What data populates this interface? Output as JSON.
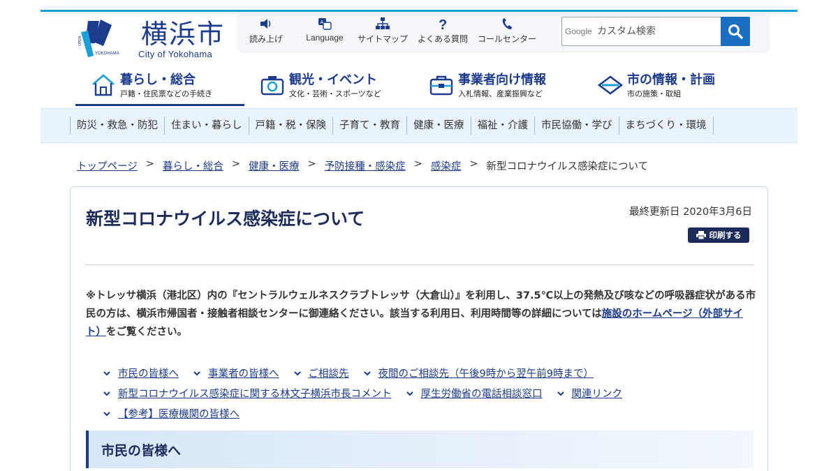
{
  "logo": {
    "mark_text_1": "OPEN",
    "mark_text_2": "YOKOHAMA",
    "kanji": "横浜市",
    "english": "City of Yokohama"
  },
  "utility": [
    {
      "label": "読み上げ",
      "icon": "speaker-icon"
    },
    {
      "label": "Language",
      "icon": "language-icon"
    },
    {
      "label": "サイトマップ",
      "icon": "sitemap-icon"
    },
    {
      "label": "よくある質問",
      "icon": "question-icon"
    },
    {
      "label": "コールセンター",
      "icon": "phone-icon"
    }
  ],
  "search": {
    "brand": "Google",
    "placeholder": "カスタム検索"
  },
  "main_nav": [
    {
      "title": "暮らし・総合",
      "sub": "戸籍・住民票などの手続き",
      "icon": "house-icon",
      "active": true
    },
    {
      "title": "観光・イベント",
      "sub": "文化・芸術・スポーツなど",
      "icon": "camera-icon",
      "active": false
    },
    {
      "title": "事業者向け情報",
      "sub": "入札情報、産業振興など",
      "icon": "briefcase-icon",
      "active": false
    },
    {
      "title": "市の情報・計画",
      "sub": "市の施策・取組",
      "icon": "diamond-icon",
      "active": false
    }
  ],
  "categories": [
    "防災・救急・防犯",
    "住まい・暮らし",
    "戸籍・税・保険",
    "子育て・教育",
    "健康・医療",
    "福祉・介護",
    "市民協働・学び",
    "まちづくり・環境"
  ],
  "breadcrumb": {
    "links": [
      "トップページ",
      "暮らし・総合",
      "健康・医療",
      "予防接種・感染症",
      "感染症"
    ],
    "separator": ">",
    "current": "新型コロナウイルス感染症について"
  },
  "page": {
    "title": "新型コロナウイルス感染症について",
    "updated": "最終更新日 2020年3月6日",
    "print_label": "印刷する",
    "notice_text": "※トレッサ横浜（港北区）内の『セントラルウェルネスクラブトレッサ（大倉山）』を利用し、37.5℃以上の発熱及び咳などの呼吸器症状がある市民の方は、横浜市帰国者・接触者相談センターに御連絡ください。該当する利用日、利用時間等の詳細については",
    "notice_link": "施設のホームページ（外部サイト）",
    "notice_tail": "をご覧ください。",
    "anchors": [
      [
        "市民の皆様へ",
        "事業者の皆様へ",
        "ご相談先",
        "夜間のご相談先（午後9時から翌午前9時まで）"
      ],
      [
        "新型コロナウイルス感染症に関する林文子横浜市長コメント",
        "厚生労働省の電話相談窓口",
        "関連リンク"
      ],
      [
        "【参考】医療機関の皆様へ"
      ]
    ],
    "section_heading": "市民の皆様へ"
  },
  "colors": {
    "brand_navy": "#1c3b8c",
    "accent_blue": "#1aa0d8",
    "search_blue": "#1b6fc2"
  }
}
